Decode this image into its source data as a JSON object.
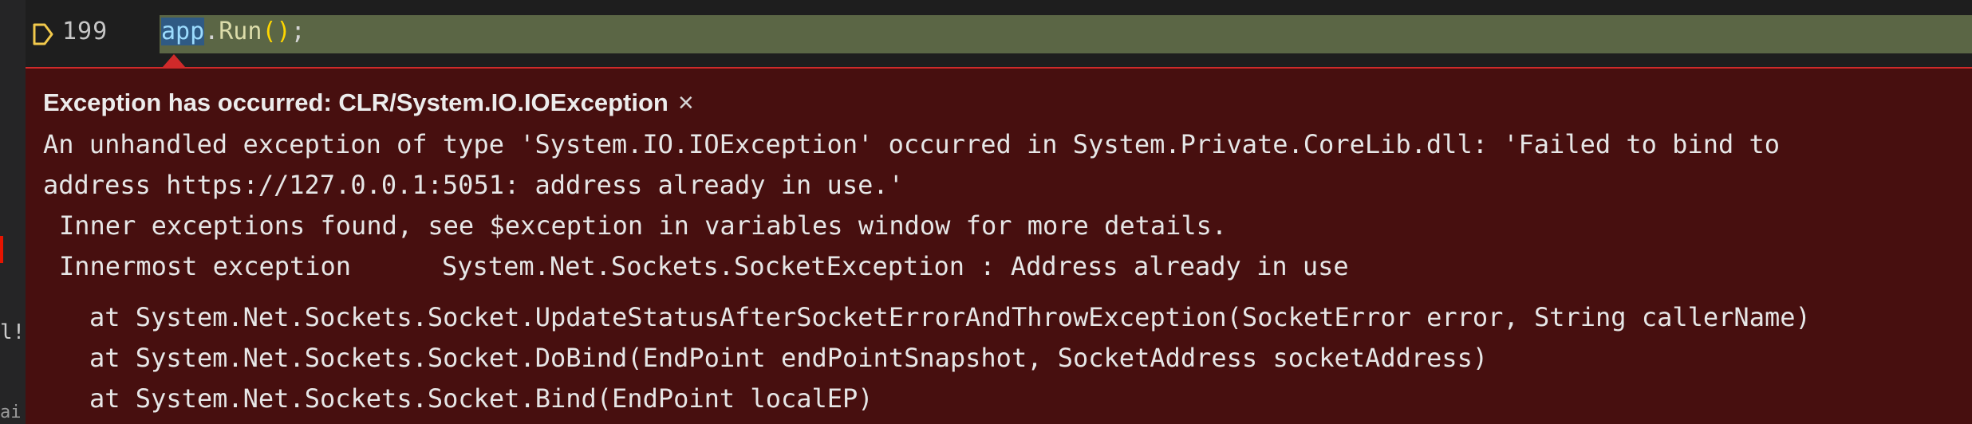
{
  "editor": {
    "prev_line_fragment": "",
    "current_line": {
      "number": "199",
      "tokens": {
        "object": "app",
        "dot": ".",
        "method": "Run",
        "parens": "()",
        "semicolon": ";"
      }
    },
    "gutter_fragments": [
      "l!",
      "ai"
    ]
  },
  "exception": {
    "title": "Exception has occurred: CLR/System.IO.IOException",
    "close_label": "×",
    "message_line1": "An unhandled exception of type 'System.IO.IOException' occurred in System.Private.CoreLib.dll: 'Failed to bind to",
    "message_line2": "address https://127.0.0.1:5051: address already in use.'",
    "inner_note": "Inner exceptions found, see $exception in variables window for more details.",
    "innermost_label": "Innermost exception",
    "innermost_value": "System.Net.Sockets.SocketException : Address already in use",
    "stack_trace": [
      "at System.Net.Sockets.Socket.UpdateStatusAfterSocketErrorAndThrowException(SocketError error, String callerName)",
      "at System.Net.Sockets.Socket.DoBind(EndPoint endPointSnapshot, SocketAddress socketAddress)",
      "at System.Net.Sockets.Socket.Bind(EndPoint localEP)"
    ]
  },
  "colors": {
    "line_highlight": "#5b6645",
    "widget_background": "#470f0f",
    "widget_border": "#d02a2a",
    "breakpoint_arrow": "#f2c94c"
  }
}
